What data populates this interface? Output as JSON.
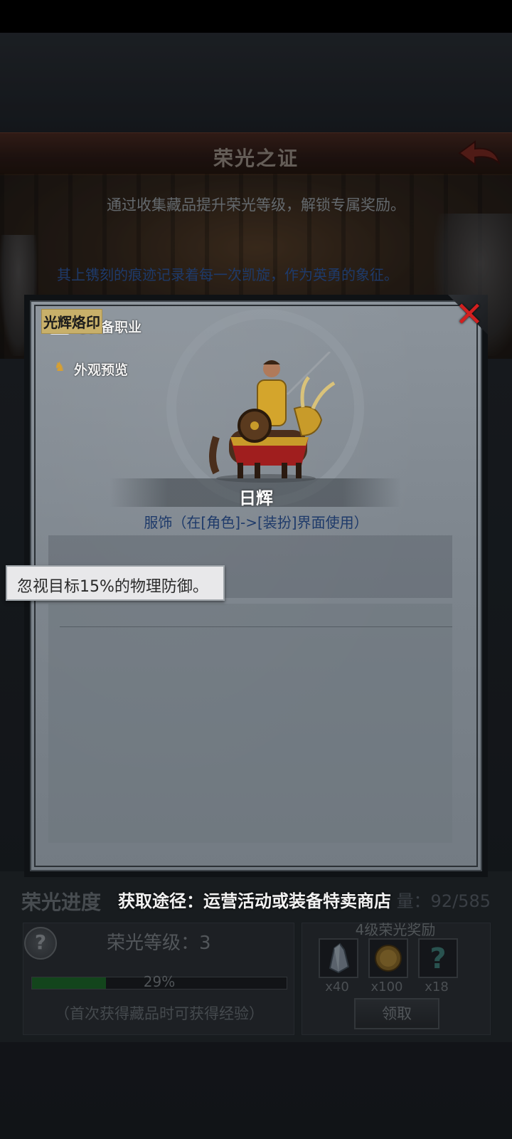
{
  "screen": {
    "title": "荣光之证",
    "subtitle": "通过收集藏品提升荣光等级，解锁专属奖励。"
  },
  "progress_section": {
    "label": "荣光进度",
    "collection_count": "量：92/585",
    "help_icon": "question-icon",
    "level_label": "荣光等级：3",
    "progress_percent": 29,
    "progress_text": "29%",
    "exp_hint": "（首次获得藏品时可获得经验）"
  },
  "rewards": {
    "title": "4级荣光奖励",
    "items": [
      {
        "icon": "crystal-icon",
        "qty": "x40"
      },
      {
        "icon": "coin-icon",
        "qty": "x100"
      },
      {
        "icon": "mystery-icon",
        "qty": "x18"
      }
    ],
    "claim_label": "领取"
  },
  "modal": {
    "side_buttons": [
      {
        "icon": "class-icon",
        "label": "可装备职业"
      },
      {
        "icon": "appearance-icon",
        "label": "外观预览"
      }
    ],
    "item_name": "日辉",
    "item_type": "服饰（在[角色]->[装扮]界面使用）",
    "description": "其上镌刻的痕迹记录着每一次凯旋，作为英勇的象征。",
    "skill_name": "光辉烙印",
    "tooltip": "忽视目标15%的物理防御。",
    "acquisition": "获取途径：运营活动或装备特卖商店"
  },
  "colors": {
    "accent_red": "#d21f1f",
    "progress_green": "#1e6a2c",
    "text_blue": "#1e3a6a",
    "gold": "#c8b06a"
  }
}
